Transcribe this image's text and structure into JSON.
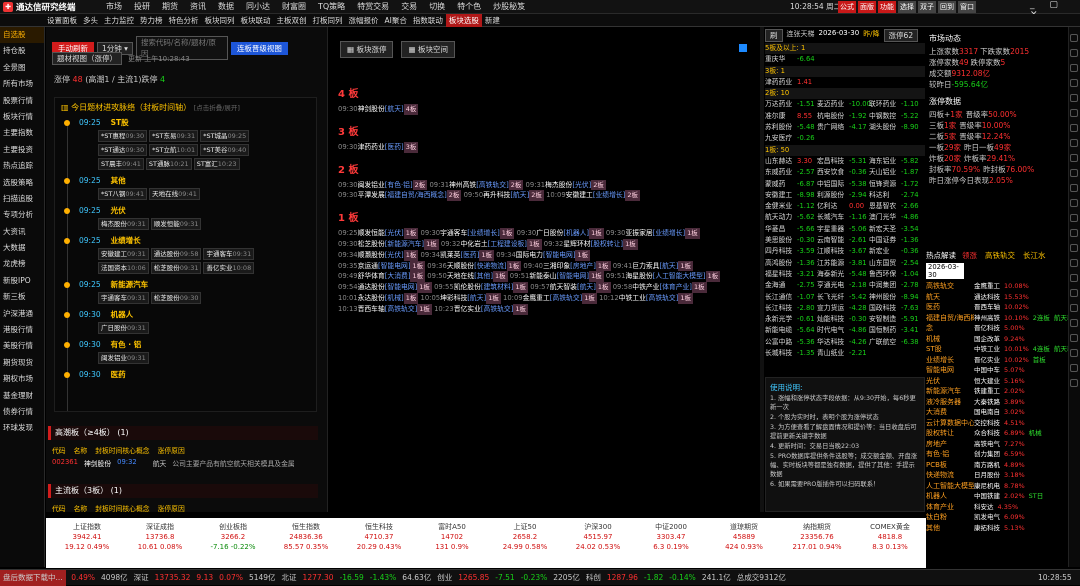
{
  "app": {
    "title": "通达信研究终端",
    "menu": [
      "市场",
      "投研",
      "期货",
      "资讯",
      "数据",
      "同小达",
      "财富圈",
      "TQ策略",
      "特赏交易",
      "交易",
      "切换",
      "特个色",
      "炒股秘笈"
    ],
    "time": "10:28:54 周二",
    "win_btns": [
      "公式",
      "面版",
      "功能",
      "选择",
      "双子",
      "回到",
      "窗口"
    ]
  },
  "toolbar": {
    "items": [
      "设置面板",
      "多头",
      "主力监控",
      "势力榜",
      "特色分析",
      "板块同列",
      "板块联动",
      "主板双创",
      "打板同列",
      "涨幅报价",
      "AI聚合",
      "指数联动",
      "板块选股",
      "新建"
    ],
    "active": "板块选股"
  },
  "sidebar": {
    "items": [
      "自选股",
      "持仓股",
      "全景图",
      "所有市场",
      "股票行情",
      "板块行情",
      "主要指数",
      "主要投资",
      "热点追踪",
      "选股策略",
      "扫描追股",
      "专项分析",
      "大资讯",
      "大数据",
      "龙虎榜",
      "新股IPO",
      "新三板",
      "沪深港通",
      "港股行情",
      "美股行情",
      "期货现货",
      "期权市场",
      "基金理财",
      "债券行情",
      "环球发现"
    ],
    "selected": "自选股"
  },
  "left": {
    "btn_refresh": "手动刷新",
    "interval": "1分钟",
    "search_placeholder": "搜索代码/名称/题材/原因",
    "btn_view": "连板晋级视图",
    "btn_big": "题材视图（涨停）",
    "update": "更新 上午10:28:43",
    "summary_label": "涨停",
    "summary_count": "48",
    "summary_detail": "(高潮1 / 主流1)跌停",
    "summary_down": "4",
    "ladder_title": "今日题材进攻脉络（封板时间轴）",
    "ladder_hint": "[点击折叠/展开]",
    "groups": [
      {
        "time": "09:25",
        "name": "ST股",
        "tags": [
          {
            "n": "*ST惠程",
            "t": "09:30"
          },
          {
            "n": "*ST东易",
            "t": "09:31"
          },
          {
            "n": "*ST城晶",
            "t": "09:25"
          },
          {
            "n": "*ST通达",
            "t": "09:30"
          },
          {
            "n": "*ST立航",
            "t": "10:01"
          },
          {
            "n": "*ST美谷",
            "t": "09:40"
          },
          {
            "n": "ST晨丰",
            "t": "09:41"
          },
          {
            "n": "ST通脉",
            "t": "10:21"
          },
          {
            "n": "ST富汇",
            "t": "10:23"
          }
        ]
      },
      {
        "time": "09:25",
        "name": "其他",
        "tags": [
          {
            "n": "*ST八钢",
            "t": "09:41"
          },
          {
            "n": "天地在线",
            "t": "09:41"
          }
        ]
      },
      {
        "time": "09:25",
        "name": "光伏",
        "tags": [
          {
            "n": "梅杰股份",
            "t": "09:31"
          },
          {
            "n": "顺发恒能",
            "t": "09:31"
          }
        ]
      },
      {
        "time": "09:25",
        "name": "业绩增长",
        "tags": [
          {
            "n": "安徽建工",
            "t": "09:31"
          },
          {
            "n": "通达股份",
            "t": "09:58"
          },
          {
            "n": "宇通客车",
            "t": "09:31"
          },
          {
            "n": "法国资本",
            "t": "10:06"
          },
          {
            "n": "松芝股份",
            "t": "09:31"
          },
          {
            "n": "善亿实业",
            "t": "10:08"
          }
        ]
      },
      {
        "time": "09:25",
        "name": "新能源汽车",
        "tags": [
          {
            "n": "宇通客车",
            "t": "09:31"
          },
          {
            "n": "松芝股份",
            "t": "09:30"
          }
        ]
      },
      {
        "time": "09:30",
        "name": "机器人",
        "tags": [
          {
            "n": "广日股份",
            "t": "09:31"
          }
        ]
      },
      {
        "time": "09:30",
        "name": "有色 · 铝",
        "tags": [
          {
            "n": "闽发铝业",
            "t": "09:31"
          }
        ]
      },
      {
        "time": "09:30",
        "name": "医药",
        "tags": []
      }
    ],
    "high_title": "高潮板（≥4板）",
    "high_count": "(1)",
    "cols": [
      "代码",
      "名称",
      "封板时间核心概念",
      "涨停原因"
    ],
    "high_row": {
      "code": "002361",
      "name": "神剑股份",
      "time": "09:32",
      "concept": "航天",
      "reason": "公司主要产品有航空航天相关模具及金属"
    },
    "main_title": "主流板（3板）",
    "main_count": "(1)"
  },
  "mid": {
    "btn1": "板块涨停",
    "btn2": "板块空间",
    "levels": [
      {
        "title": "4 板",
        "lines": [
          [
            [
              "09:30",
              "神剑股份",
              "航天",
              "4板"
            ]
          ]
        ]
      },
      {
        "title": "3 板",
        "lines": [
          [
            [
              "09:30",
              "津药药业",
              "医药",
              "3板"
            ]
          ]
        ]
      },
      {
        "title": "2 板",
        "lines": [
          [
            [
              "09:30",
              "闽发铝业",
              "有色·铝",
              "2板"
            ],
            [
              "09:31",
              "神州高铁",
              "高铁轨交",
              "2板"
            ],
            [
              "09:31",
              "梅杰股份",
              "光伏",
              "2板"
            ]
          ],
          [
            [
              "09:30",
              "平潭发展",
              "福建自贸/海西概念",
              "2板"
            ],
            [
              "09:50",
              "再升科技",
              "航天",
              "2板"
            ],
            [
              "10:09",
              "安徽建工",
              "业绩增长",
              "2板"
            ]
          ]
        ]
      },
      {
        "title": "1 板",
        "lines": [
          [
            [
              "09:25",
              "顺发恒能",
              "光伏",
              "1板"
            ],
            [
              "09:30",
              "宇通客车",
              "业绩增长",
              "1板"
            ],
            [
              "09:30",
              "广日股份",
              "机器人",
              "1板"
            ],
            [
              "09:30",
              "亚振家居",
              "业绩增长",
              "1板"
            ]
          ],
          [
            [
              "09:30",
              "松芝股份",
              "新能源汽车",
              "1板"
            ],
            [
              "09:32",
              "中化岩土",
              "工程建设板",
              "1板"
            ],
            [
              "09:32",
              "星辉环材",
              "股权转让",
              "1板"
            ]
          ],
          [
            [
              "09:34",
              "顺灏股份",
              "光伏",
              "1板"
            ],
            [
              "09:34",
              "凯莱英",
              "医药",
              "1板"
            ],
            [
              "09:34",
              "国际电力",
              "智能电网",
              "1板"
            ]
          ],
          [
            [
              "09:35",
              "京运通",
              "智能电网",
              "1板"
            ],
            [
              "09:36",
              "天顺股份",
              "快递物流",
              "1板"
            ],
            [
              "09:40",
              "三湘印象",
              "房地产",
              "1板"
            ],
            [
              "09:41",
              "巨力索具",
              "航天",
              "1板"
            ]
          ],
          [
            [
              "09:49",
              "舒华体育",
              "大消费",
              "1板"
            ],
            [
              "09:50",
              "天地在线",
              "其他",
              "1板"
            ],
            [
              "09:51",
              "新能泰山",
              "智能电网",
              "1板"
            ],
            [
              "09:51",
              "海星股份",
              "人工智能大模型",
              "1板"
            ]
          ],
          [
            [
              "09:54",
              "通达股份",
              "智能电网",
              "1板"
            ],
            [
              "09:55",
              "凯伦股份",
              "建筑材料",
              "1板"
            ],
            [
              "09:57",
              "航天智装",
              "航天",
              "1板"
            ],
            [
              "09:58",
              "中铁产业",
              "体育产业",
              "1板"
            ]
          ],
          [
            [
              "10:01",
              "永达股份",
              "机械",
              "1板"
            ],
            [
              "10:05",
              "坤彩科技",
              "航天",
              "1板"
            ],
            [
              "10:09",
              "金鹰重工",
              "高铁轨交",
              "1板"
            ],
            [
              "10:12",
              "中铁工业",
              "高铁轨交",
              "1板"
            ]
          ],
          [
            [
              "10:13",
              "晋西车轴",
              "高铁轨交",
              "1板"
            ],
            [
              "10:23",
              "晋亿实业",
              "高铁轨交",
              "1板"
            ]
          ]
        ]
      }
    ]
  },
  "right": {
    "tab1": "刷",
    "tab2": "连张天梯",
    "date": "2026-03-30",
    "tab3": "昨/降",
    "tab4": "涨停62",
    "ladder": [
      {
        "h": "5板及以上: 1",
        "rows": [
          [
            "重庆华",
            "-6.64"
          ]
        ]
      },
      {
        "h": "3板: 1",
        "rows": [
          [
            "津药药业",
            "1.41"
          ]
        ]
      },
      {
        "h": "2板: 10",
        "rows": [
          [
            "万达药业",
            "-1.51",
            "麦迈药业",
            "-10.00",
            "联环药业",
            "-1.10"
          ],
          [
            "准尔康",
            "8.55",
            "杭电股份",
            "-1.92",
            "中钢数控",
            "-5.22"
          ],
          [
            "苏利股份",
            "-5.48",
            "贵广网络",
            "-4.17",
            "湖头股份",
            "-8.90"
          ],
          [
            "九安医疗",
            "-0.26"
          ]
        ]
      },
      {
        "h": "1板: 50",
        "rows": [
          [
            "山东赫达",
            "3.30",
            "宏昌科技",
            "-5.31",
            "海东铝业",
            "-5.82"
          ],
          [
            "东威药业",
            "-2.57",
            "西安饮食",
            "-0.36",
            "天山铝业",
            "-1.87"
          ],
          [
            "蒙威药",
            "-6.87",
            "中铝国际",
            "-5.38",
            "恒锋资源",
            "-1.72"
          ],
          [
            "安徽建工",
            "-8.98",
            "利源股份",
            "-2.94",
            "科达利",
            "-2.74"
          ],
          [
            "金健米业",
            "-1.12",
            "亿利达",
            "0.00",
            "恩基智农",
            "-2.66"
          ],
          [
            "航天动力",
            "-5.62",
            "长城汽车",
            "-1.16",
            "澳门光华",
            "-4.86"
          ],
          [
            "华菱昌",
            "-5.66",
            "宇星重器",
            "-5.06",
            "新宏天圣",
            "-3.54"
          ],
          [
            "美思股份",
            "-0.30",
            "云南智能",
            "-2.61",
            "中国证券",
            "-1.36"
          ],
          [
            "四丹科技",
            "-3.59",
            "江顺科技",
            "-3.67",
            "新宏业",
            "-0.36"
          ],
          [
            "高鸿股份",
            "-1.36",
            "江苏能源",
            "-3.81",
            "山东国贸",
            "-2.54"
          ],
          [
            "福星科技",
            "-3.21",
            "海泰新光",
            "-5.48",
            "鲁西环保",
            "-1.04"
          ],
          [
            "金海通",
            "-2.75",
            "亨通光电",
            "-2.18",
            "中润集团",
            "-2.78"
          ],
          [
            "长江通信",
            "-1.07",
            "长飞光纤",
            "-5.42",
            "神州股份",
            "-8.94"
          ],
          [
            "长江科技",
            "-2.80",
            "宣力货运",
            "-4.28",
            "国政科技",
            "-7.63"
          ],
          [
            "永新光学",
            "-0.61",
            "灿能科技",
            "-0.30",
            "安智制造",
            "-5.91"
          ],
          [
            "新能电缆",
            "-5.64",
            "时代电气",
            "-4.86",
            "国恒制药",
            "-3.41"
          ],
          [
            "公富中路",
            "-5.36",
            "华达科技",
            "-4.26",
            "广联航空",
            "-6.38"
          ],
          [
            "长城科技",
            "-1.35",
            "青山纸业",
            "-2.21"
          ]
        ]
      }
    ],
    "mkt_title": "市场动态",
    "mkt": [
      [
        "上涨家数",
        "3317",
        "下跌家数",
        "2015"
      ],
      [
        "涨停家数",
        "49",
        "跌停家数",
        "5"
      ],
      [
        "成交额",
        "9312.08亿",
        "",
        " "
      ],
      [
        "较昨日",
        "-595.64亿",
        "",
        ""
      ]
    ],
    "stat_title": "涨停数据",
    "stats": [
      [
        "四板+",
        "1家",
        "晋级率",
        "50.00%"
      ],
      [
        "三板",
        "1家",
        "晋级率",
        "10.00%"
      ],
      [
        "二板",
        "5家",
        "晋级率",
        "12.24%"
      ],
      [
        "一板",
        "29家",
        "昨日一板",
        "49家"
      ],
      [
        "炸板",
        "20家",
        "炸板率",
        "29.41%"
      ],
      [
        "封板率",
        "70.59%",
        "昨封板",
        "76.00%"
      ],
      [
        "昨日涨停今日表现",
        "2.05%",
        "",
        ""
      ]
    ],
    "guide_title": "使用说明:",
    "guide": [
      "1. 涨幅和涨停状态字段依据：从9:30开始，每6秒更新一次",
      "2. 个股为实时时，表明个股为涨停状态",
      "3. 为方便查看了解盘面情况和提价等：当日收盘后可提前更新关键字数据",
      "4. 更新时间：交易日当晚22:03",
      "5. PRO数据库提供条件选股等；成交额金额、开盘涨幅、实时板块等都是独有数据，提供了其他：手提示数据",
      "6. 如果需要PRO版插件可以扫码联系！"
    ]
  },
  "hot": {
    "title": "热点解读",
    "date": "2026-03-30",
    "col1": [
      "高铁轨交",
      "航天",
      "医药",
      "福建自贸/海西概",
      "念",
      "机械",
      "ST股",
      "业绩增长",
      "智能电网",
      "光伏",
      "新能源汽车",
      "液冷服务器",
      "大消费",
      "云计算数据中心",
      "股权转让",
      "房地产",
      "有色·铝",
      "PCB板",
      "快递物流",
      "人工智能大模型",
      "机器人",
      "体育产业",
      "钛白粉",
      "其他"
    ],
    "cols": [
      "领涨",
      "高铁轨交",
      "长江水"
    ],
    "col2": [
      [
        "金鹰重工",
        "10.08%"
      ],
      [
        "通达科技",
        "15.53%"
      ],
      [
        "晋西车轴",
        "10.02%"
      ],
      [
        "神州高铁",
        "10.10%",
        "2连板",
        "航天装"
      ],
      [
        "晋亿科技",
        "5.00%"
      ],
      [
        "国企改革",
        "9.24%"
      ],
      [
        "中铁工业",
        "10.01%",
        "4连板",
        "航天装"
      ],
      [
        "晋亿实业",
        "10.02%",
        "首板"
      ],
      [
        "中国中车",
        "5.07%"
      ],
      [
        "恒大建业",
        "5.16%"
      ],
      [
        "铁建重工",
        "2.02%"
      ],
      [
        "大秦铁路",
        "3.89%"
      ],
      [
        "国电南自",
        "3.02%"
      ],
      [
        "交控科技",
        "4.51%"
      ],
      [
        "众合科技",
        "6.89%",
        "机械"
      ],
      [
        "高铁电气",
        "7.27%"
      ],
      [
        "创力集团",
        "6.59%"
      ],
      [
        "南方路机",
        "4.89%"
      ],
      [
        "日月股份",
        "3.18%"
      ],
      [
        "康尼机电",
        "8.78%"
      ],
      [
        "中国铁建",
        "2.02%",
        "ST日"
      ],
      [
        "科安达",
        "4.35%"
      ],
      [
        "凯发电气",
        "6.09%"
      ],
      [
        "康拓科技",
        "5.13%"
      ]
    ]
  },
  "idx": [
    {
      "n": "上证指数",
      "v": "3942.41",
      "c": "19.12",
      "p": "0.49%"
    },
    {
      "n": "深证成指",
      "v": "13736.8",
      "c": "10.61",
      "p": "0.08%"
    },
    {
      "n": "创业板指",
      "v": "3266.2",
      "c": "-7.16",
      "p": "-0.22%"
    },
    {
      "n": "恒生指数",
      "v": "24836.36",
      "c": "85.57",
      "p": "0.35%"
    },
    {
      "n": "恒生科技",
      "v": "4710.37",
      "c": "20.29",
      "p": "0.43%"
    },
    {
      "n": "富时A50",
      "v": "14702",
      "c": "131",
      "p": "0.9%"
    },
    {
      "n": "上证50",
      "v": "2658.2",
      "c": "24.99",
      "p": "0.58%"
    },
    {
      "n": "沪深300",
      "v": "4515.97",
      "c": "24.02",
      "p": "0.53%"
    },
    {
      "n": "中证2000",
      "v": "3303.47",
      "c": "6.3",
      "p": "0.19%"
    },
    {
      "n": "道琼期货",
      "v": "45889",
      "c": "424",
      "p": "0.93%"
    },
    {
      "n": "纳指期货",
      "v": "23356.76",
      "c": "217.01",
      "p": "0.94%"
    },
    {
      "n": "COMEX黄金",
      "v": "4818.8",
      "c": "8.3",
      "p": "0.13%"
    }
  ],
  "status": {
    "down": "盘后数据下载中...",
    "items": [
      "0.49%",
      "4098亿",
      "深证",
      "13735.32",
      "9.13",
      "0.07%",
      "5149亿",
      "北证",
      "1277.30",
      "-16.59",
      "-1.43%",
      "64.63亿",
      "创业",
      "1265.85",
      "-7.51",
      "-0.23%",
      "2205亿",
      "科创",
      "1287.96",
      "-1.82",
      "-0.14%",
      "241.1亿",
      "总成交9312亿"
    ],
    "clock": "10:28:55"
  }
}
